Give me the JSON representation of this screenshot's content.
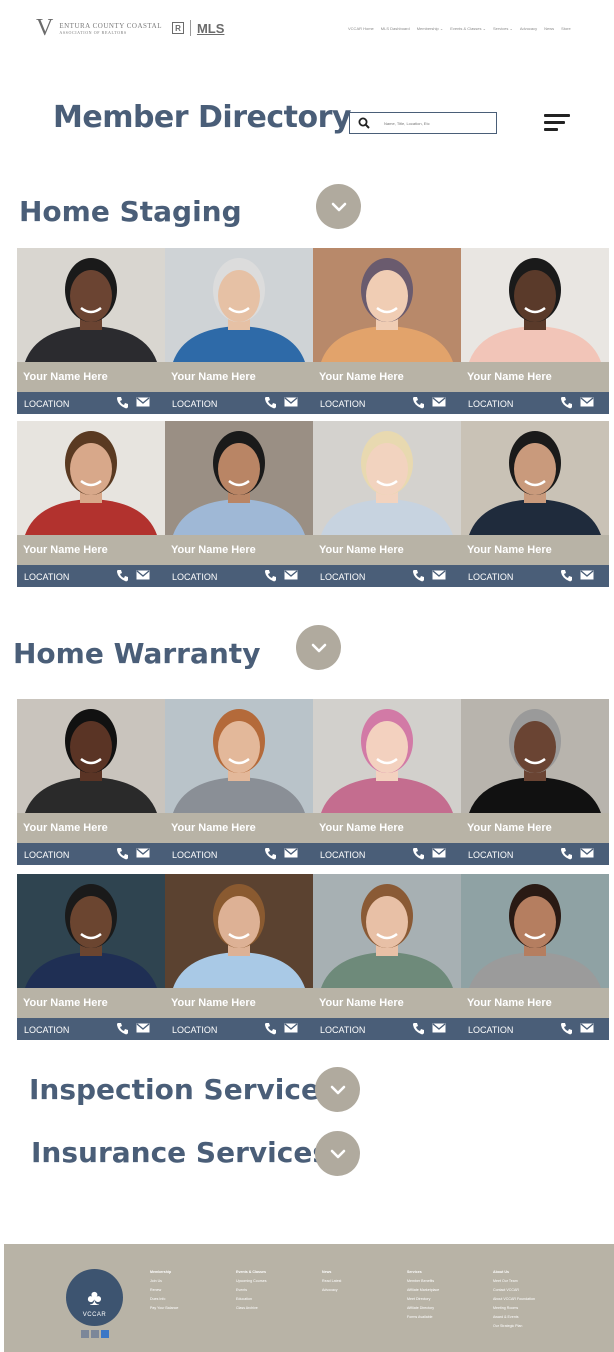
{
  "header": {
    "logo_letter": "V",
    "logo_line1": "ENTURA COUNTY COASTAL",
    "logo_line2": "ASSOCIATION OF REALTORS",
    "logo_r": "R",
    "logo_mls": "MLS",
    "nav": [
      "VCCAR Home",
      "MLS Dashboard",
      "Membership ⌄",
      "Events & Classes ⌄",
      "Services ⌄",
      "Advocacy",
      "News",
      "Store"
    ]
  },
  "title": "Member Directory",
  "search": {
    "placeholder": "Name, Title, Location, Etc"
  },
  "card_labels": {
    "name": "Your Name Here",
    "location": "LOCATION"
  },
  "sections": [
    {
      "title": "Home Staging",
      "rows": 2
    },
    {
      "title": "Home Warranty",
      "rows": 2
    },
    {
      "title": "Inspection Services"
    },
    {
      "title": "Insurance Services"
    }
  ],
  "footer": {
    "logo_text": "VCCAR",
    "columns": [
      {
        "heading": "Membership",
        "items": [
          "Join Us",
          "Renew",
          "Dues Info",
          "Pay Your Balance"
        ]
      },
      {
        "heading": "Events & Classes",
        "items": [
          "Upcoming Courses",
          "Events",
          "Education",
          "Class Archive"
        ]
      },
      {
        "heading": "News",
        "items": [
          "Read Latest",
          "Advocacy"
        ]
      },
      {
        "heading": "Services",
        "items": [
          "Member Benefits",
          "Affiliate Marketplace",
          "Meet Directory",
          "Affiliate Directory",
          "Forms Available"
        ]
      },
      {
        "heading": "About Us",
        "items": [
          "Meet Our Team",
          "Contact VCCAR",
          "About VCCAR Foundation",
          "Meeting Rooms",
          "Award & Events",
          "Our Strategic Plan"
        ]
      }
    ]
  },
  "colors": {
    "accent": "#4a5e78",
    "band": "#b8b3a6",
    "chevron": "#b0aa9e"
  }
}
